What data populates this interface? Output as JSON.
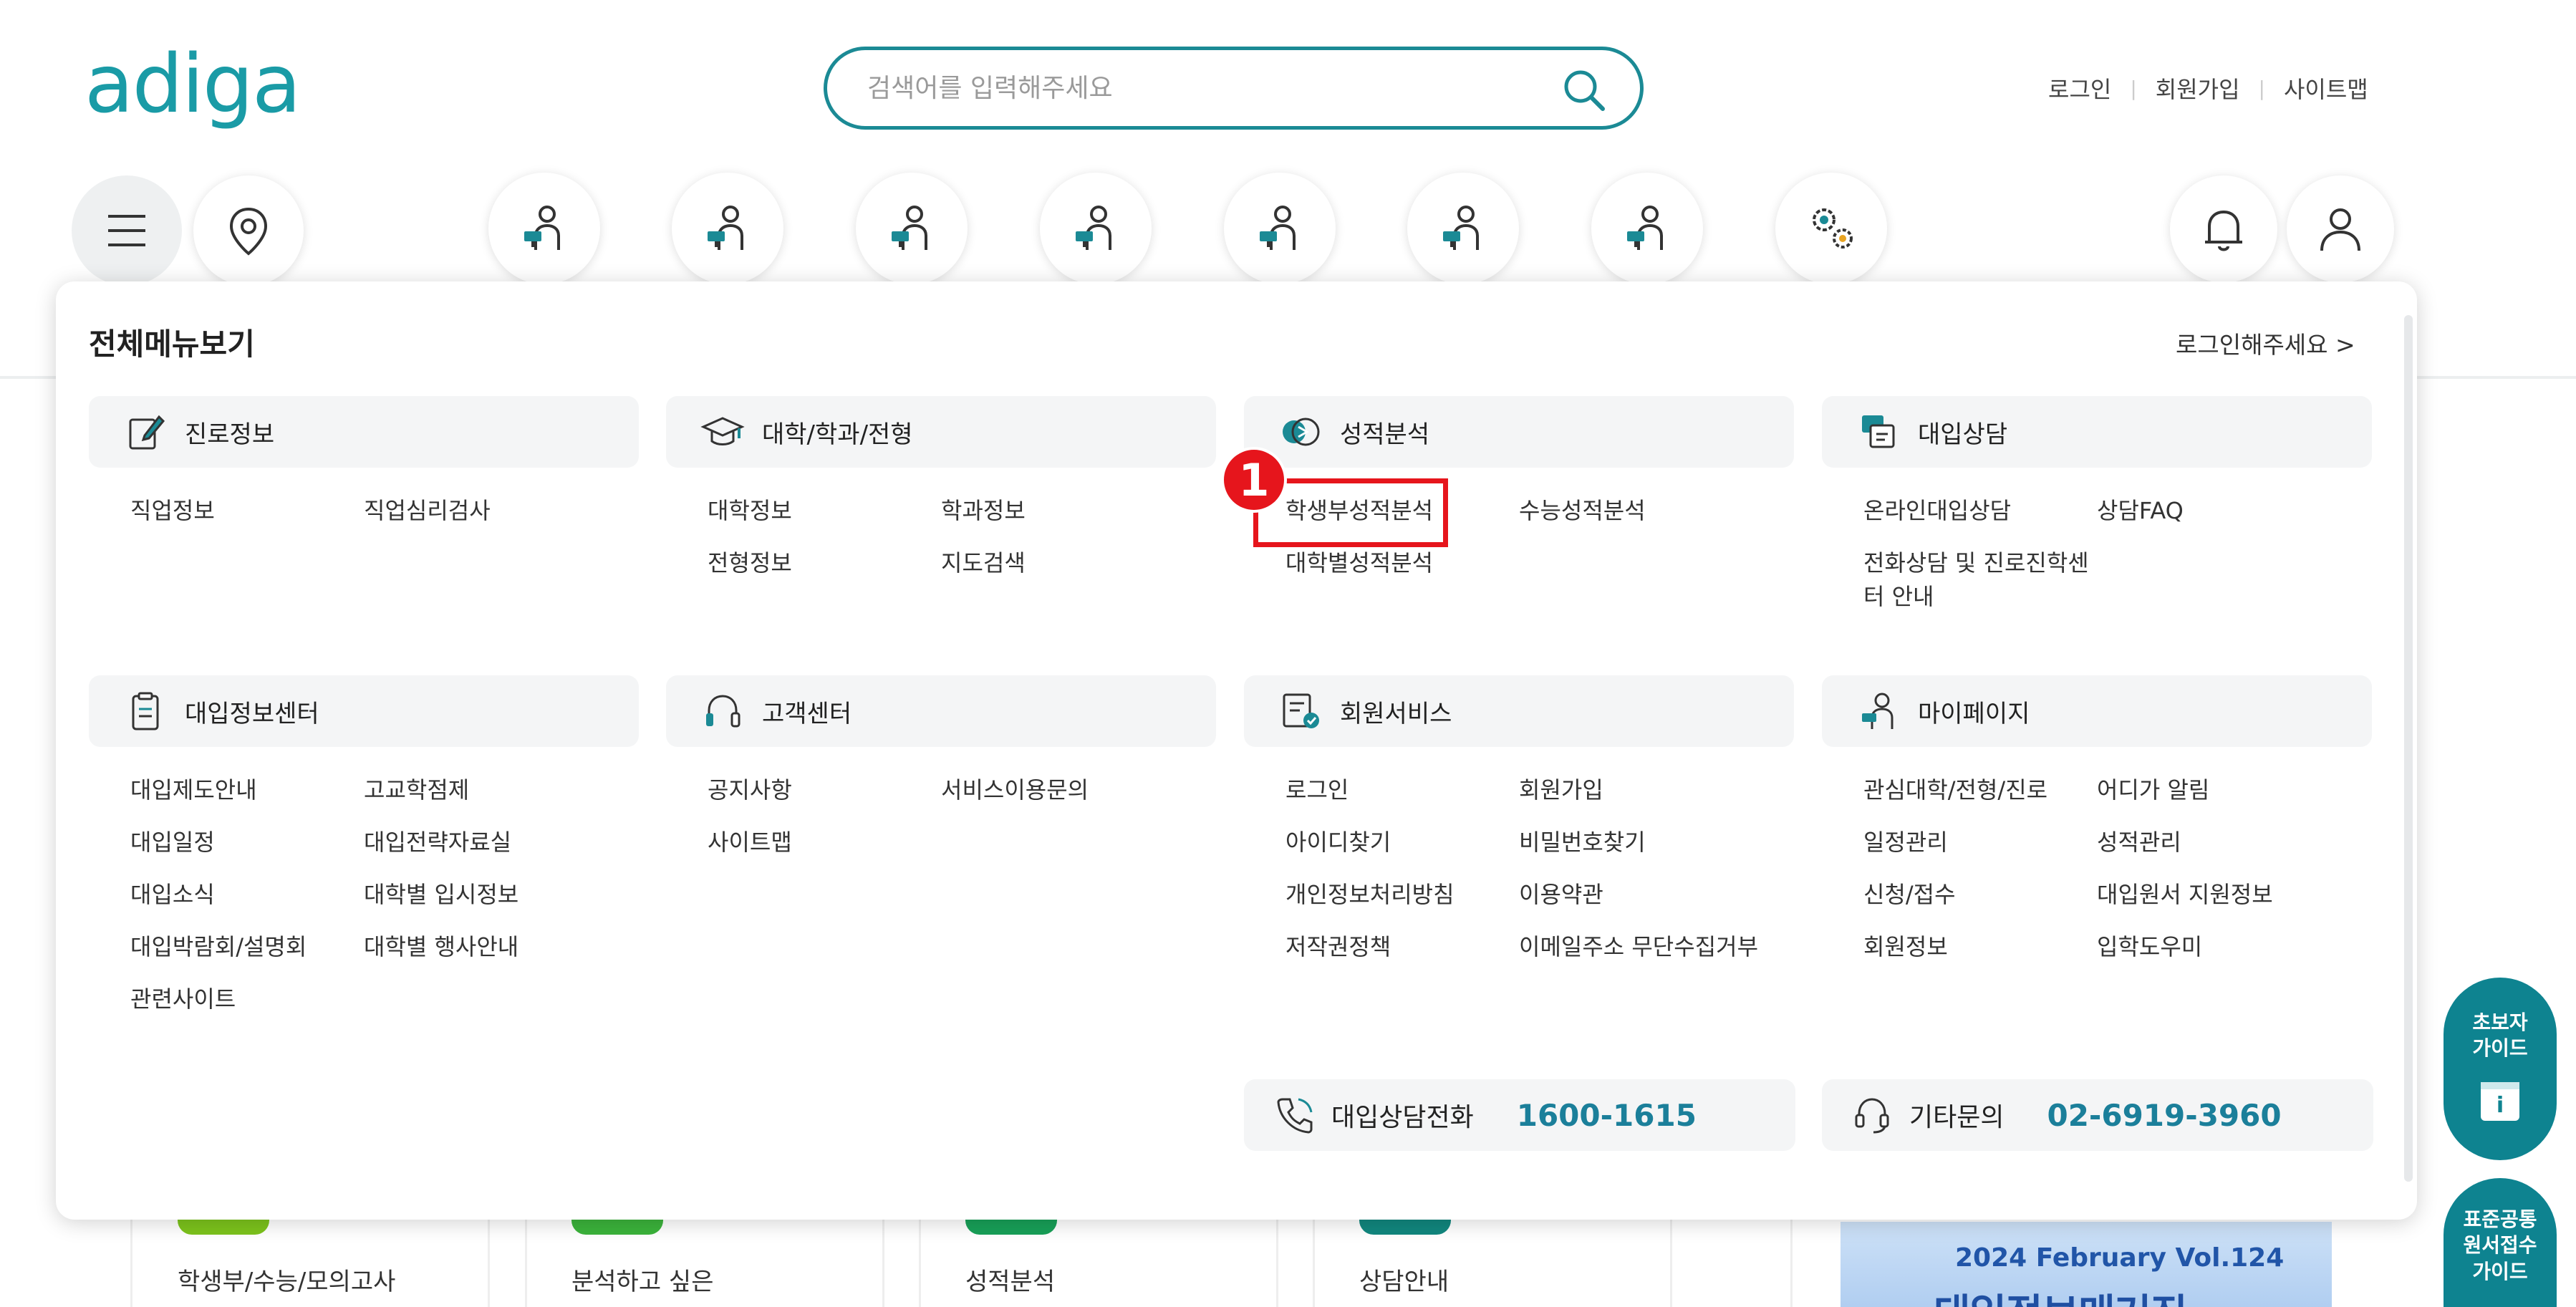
{
  "header": {
    "logo": "adiga",
    "search_placeholder": "검색어를 입력해주세요",
    "links": [
      "로그인",
      "회원가입",
      "사이트맵"
    ]
  },
  "nav_icons": [
    "menu-icon",
    "location-icon",
    "person-board-icon",
    "person-board-icon",
    "person-board-icon",
    "person-board-icon",
    "person-board-icon",
    "person-board-icon",
    "person-board-icon",
    "gears-icon",
    "bell-icon",
    "user-icon"
  ],
  "panel": {
    "title": "전체메뉴보기",
    "login_prompt": "로그인해주세요 >",
    "sections": [
      {
        "title": "진로정보",
        "icon": "edit-note-icon",
        "items": [
          "직업정보",
          "직업심리검사"
        ]
      },
      {
        "title": "대학/학과/전형",
        "icon": "graduation-cap-icon",
        "items": [
          "대학정보",
          "학과정보",
          "전형정보",
          "지도검색"
        ]
      },
      {
        "title": "성적분석",
        "icon": "score-analysis-icon",
        "items": [
          "학생부성적분석",
          "수능성적분석",
          "대학별성적분석"
        ]
      },
      {
        "title": "대입상담",
        "icon": "counsel-icon",
        "items": [
          "온라인대입상담",
          "상담FAQ",
          "전화상담 및 진로진학센",
          "터 안내"
        ]
      },
      {
        "title": "대입정보센터",
        "icon": "clipboard-icon",
        "items": [
          "대입제도안내",
          "고교학점제",
          "대입일정",
          "대입전략자료실",
          "대입소식",
          "대학별 입시정보",
          "대입박람회/설명회",
          "대학별 행사안내",
          "관련사이트"
        ]
      },
      {
        "title": "고객센터",
        "icon": "headset-icon",
        "items": [
          "공지사항",
          "서비스이용문의",
          "사이트맵"
        ]
      },
      {
        "title": "회원서비스",
        "icon": "member-service-icon",
        "items": [
          "로그인",
          "회원가입",
          "아이디찾기",
          "비밀번호찾기",
          "개인정보처리방침",
          "이용약관",
          "저작권정책",
          "이메일주소 무단수집거부"
        ]
      },
      {
        "title": "마이페이지",
        "icon": "mypage-icon",
        "items": [
          "관심대학/전형/진로",
          "어디가 알림",
          "일정관리",
          "성적관리",
          "신청/접수",
          "대입원서 지원정보",
          "회원정보",
          "입학도우미"
        ]
      }
    ],
    "phones": [
      {
        "label": "대입상담전화",
        "number": "1600-1615"
      },
      {
        "label": "기타문의",
        "number": "02-6919-3960"
      }
    ],
    "step_badge": "1"
  },
  "float_buttons": [
    {
      "label_1": "초보자",
      "label_2": "가이드"
    },
    {
      "label_1": "표준공통",
      "label_2": "원서접수",
      "label_3": "가이드"
    }
  ],
  "cards": [
    "학생부/수능/모의고사",
    "분석하고 싶은",
    "성적분석",
    "상담안내"
  ],
  "banner": {
    "line1": "2024 February Vol.124",
    "line2": "대입정보매거진"
  },
  "colors": {
    "brand": "#1a9ba6",
    "search_border": "#1b8a95",
    "highlight": "#e6151c",
    "phone_number": "#1b7f9a",
    "float_bg": "#0e8390"
  }
}
